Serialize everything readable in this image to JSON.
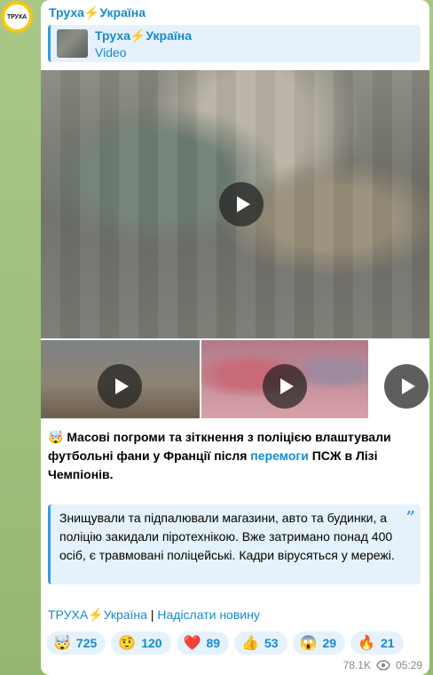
{
  "channel": {
    "name": "Труха⚡Україна",
    "avatar_text": "ТРУХА"
  },
  "reply": {
    "title": "Труха⚡Україна",
    "subtitle": "Video"
  },
  "message": {
    "lead_emoji": "🤯",
    "text_before": "Масові погроми та зіткнення з поліцією влаштували футбольні фани у Франції після ",
    "link_text": "перемоги",
    "text_after": " ПСЖ в Лізі Чемпіонів.",
    "quote": "Знищували та підпалювали магазини, авто та будинки, а поліцію закидали піротехнікою. Вже затримано понад 400 осіб, є травмовані поліцейські. Кадри вірусяться у мережі."
  },
  "footer": {
    "link1": "ТРУХА⚡Україна",
    "separator": " | ",
    "link2": "Надіслати новину"
  },
  "reactions": [
    {
      "emoji": "🤯",
      "count": "725"
    },
    {
      "emoji": "🤨",
      "count": "120"
    },
    {
      "emoji": "❤️",
      "count": "89"
    },
    {
      "emoji": "👍",
      "count": "53"
    },
    {
      "emoji": "😱",
      "count": "29"
    },
    {
      "emoji": "🔥",
      "count": "21"
    }
  ],
  "meta": {
    "views": "78.1K",
    "time": "05:29"
  },
  "colors": {
    "accent": "#168acd",
    "quote_bg": "#e6f2fb"
  }
}
